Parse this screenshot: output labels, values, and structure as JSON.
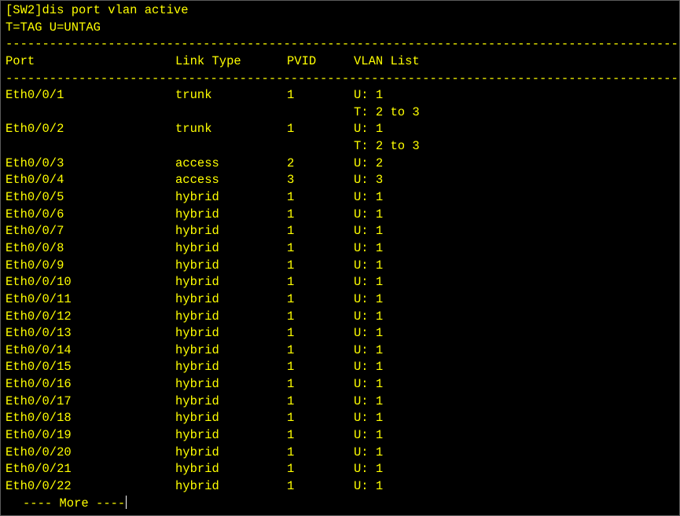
{
  "terminal": {
    "command_line": "[SW2]dis port vlan active",
    "legend": "T=TAG U=UNTAG",
    "separator": "---------------------------------------------------------------------------------------------",
    "headers": {
      "port": "Port",
      "link_type": "Link Type",
      "pvid": "PVID",
      "vlan_list": "VLAN List"
    },
    "rows": [
      {
        "port": "Eth0/0/1",
        "link_type": "trunk",
        "pvid": "1",
        "vlan": "U: 1"
      },
      {
        "port": "",
        "link_type": "",
        "pvid": "",
        "vlan": "T: 2 to 3"
      },
      {
        "port": "Eth0/0/2",
        "link_type": "trunk",
        "pvid": "1",
        "vlan": "U: 1"
      },
      {
        "port": "",
        "link_type": "",
        "pvid": "",
        "vlan": "T: 2 to 3"
      },
      {
        "port": "Eth0/0/3",
        "link_type": "access",
        "pvid": "2",
        "vlan": "U: 2"
      },
      {
        "port": "Eth0/0/4",
        "link_type": "access",
        "pvid": "3",
        "vlan": "U: 3"
      },
      {
        "port": "Eth0/0/5",
        "link_type": "hybrid",
        "pvid": "1",
        "vlan": "U: 1"
      },
      {
        "port": "Eth0/0/6",
        "link_type": "hybrid",
        "pvid": "1",
        "vlan": "U: 1"
      },
      {
        "port": "Eth0/0/7",
        "link_type": "hybrid",
        "pvid": "1",
        "vlan": "U: 1"
      },
      {
        "port": "Eth0/0/8",
        "link_type": "hybrid",
        "pvid": "1",
        "vlan": "U: 1"
      },
      {
        "port": "Eth0/0/9",
        "link_type": "hybrid",
        "pvid": "1",
        "vlan": "U: 1"
      },
      {
        "port": "Eth0/0/10",
        "link_type": "hybrid",
        "pvid": "1",
        "vlan": "U: 1"
      },
      {
        "port": "Eth0/0/11",
        "link_type": "hybrid",
        "pvid": "1",
        "vlan": "U: 1"
      },
      {
        "port": "Eth0/0/12",
        "link_type": "hybrid",
        "pvid": "1",
        "vlan": "U: 1"
      },
      {
        "port": "Eth0/0/13",
        "link_type": "hybrid",
        "pvid": "1",
        "vlan": "U: 1"
      },
      {
        "port": "Eth0/0/14",
        "link_type": "hybrid",
        "pvid": "1",
        "vlan": "U: 1"
      },
      {
        "port": "Eth0/0/15",
        "link_type": "hybrid",
        "pvid": "1",
        "vlan": "U: 1"
      },
      {
        "port": "Eth0/0/16",
        "link_type": "hybrid",
        "pvid": "1",
        "vlan": "U: 1"
      },
      {
        "port": "Eth0/0/17",
        "link_type": "hybrid",
        "pvid": "1",
        "vlan": "U: 1"
      },
      {
        "port": "Eth0/0/18",
        "link_type": "hybrid",
        "pvid": "1",
        "vlan": "U: 1"
      },
      {
        "port": "Eth0/0/19",
        "link_type": "hybrid",
        "pvid": "1",
        "vlan": "U: 1"
      },
      {
        "port": "Eth0/0/20",
        "link_type": "hybrid",
        "pvid": "1",
        "vlan": "U: 1"
      },
      {
        "port": "Eth0/0/21",
        "link_type": "hybrid",
        "pvid": "1",
        "vlan": "U: 1"
      },
      {
        "port": "Eth0/0/22",
        "link_type": "hybrid",
        "pvid": "1",
        "vlan": "U: 1"
      }
    ],
    "more_prompt": "---- More ----"
  },
  "colors": {
    "background": "#000000",
    "text": "#ffff00",
    "cursor": "#ffffff"
  }
}
